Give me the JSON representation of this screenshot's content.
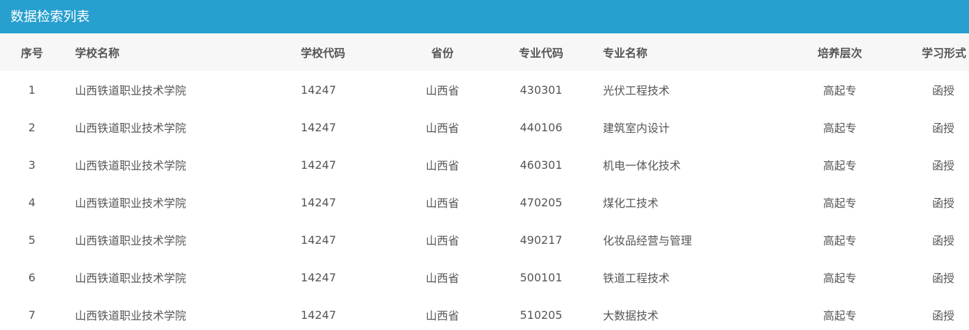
{
  "panel": {
    "title": "数据检索列表"
  },
  "table": {
    "headers": {
      "index": "序号",
      "school_name": "学校名称",
      "school_code": "学校代码",
      "province": "省份",
      "major_code": "专业代码",
      "major_name": "专业名称",
      "level": "培养层次",
      "study_mode": "学习形式"
    },
    "rows": [
      {
        "index": "1",
        "school_name": "山西铁道职业技术学院",
        "school_code": "14247",
        "province": "山西省",
        "major_code": "430301",
        "major_name": "光伏工程技术",
        "level": "高起专",
        "study_mode": "函授"
      },
      {
        "index": "2",
        "school_name": "山西铁道职业技术学院",
        "school_code": "14247",
        "province": "山西省",
        "major_code": "440106",
        "major_name": "建筑室内设计",
        "level": "高起专",
        "study_mode": "函授"
      },
      {
        "index": "3",
        "school_name": "山西铁道职业技术学院",
        "school_code": "14247",
        "province": "山西省",
        "major_code": "460301",
        "major_name": "机电一体化技术",
        "level": "高起专",
        "study_mode": "函授"
      },
      {
        "index": "4",
        "school_name": "山西铁道职业技术学院",
        "school_code": "14247",
        "province": "山西省",
        "major_code": "470205",
        "major_name": "煤化工技术",
        "level": "高起专",
        "study_mode": "函授"
      },
      {
        "index": "5",
        "school_name": "山西铁道职业技术学院",
        "school_code": "14247",
        "province": "山西省",
        "major_code": "490217",
        "major_name": "化妆品经营与管理",
        "level": "高起专",
        "study_mode": "函授"
      },
      {
        "index": "6",
        "school_name": "山西铁道职业技术学院",
        "school_code": "14247",
        "province": "山西省",
        "major_code": "500101",
        "major_name": "铁道工程技术",
        "level": "高起专",
        "study_mode": "函授"
      },
      {
        "index": "7",
        "school_name": "山西铁道职业技术学院",
        "school_code": "14247",
        "province": "山西省",
        "major_code": "510205",
        "major_name": "大数据技术",
        "level": "高起专",
        "study_mode": "函授"
      }
    ]
  },
  "colors": {
    "header_bar": "#279fcf",
    "table_head_bg": "#f7f7f7",
    "text": "#555555"
  }
}
